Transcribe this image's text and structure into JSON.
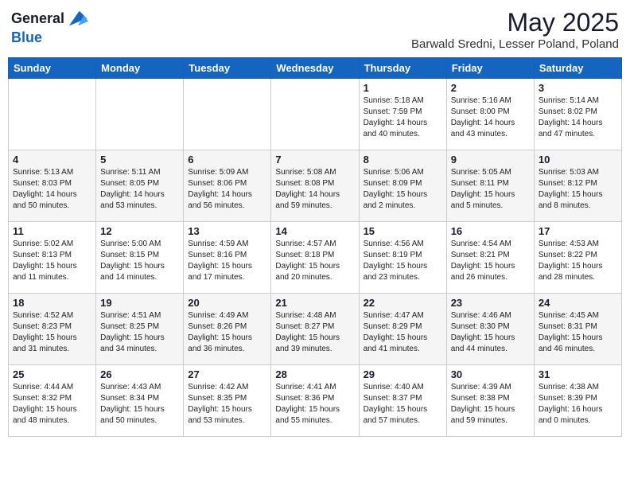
{
  "header": {
    "logo_line1": "General",
    "logo_line2": "Blue",
    "month": "May 2025",
    "location": "Barwald Sredni, Lesser Poland, Poland"
  },
  "weekdays": [
    "Sunday",
    "Monday",
    "Tuesday",
    "Wednesday",
    "Thursday",
    "Friday",
    "Saturday"
  ],
  "weeks": [
    [
      {
        "day": "",
        "info": ""
      },
      {
        "day": "",
        "info": ""
      },
      {
        "day": "",
        "info": ""
      },
      {
        "day": "",
        "info": ""
      },
      {
        "day": "1",
        "info": "Sunrise: 5:18 AM\nSunset: 7:59 PM\nDaylight: 14 hours\nand 40 minutes."
      },
      {
        "day": "2",
        "info": "Sunrise: 5:16 AM\nSunset: 8:00 PM\nDaylight: 14 hours\nand 43 minutes."
      },
      {
        "day": "3",
        "info": "Sunrise: 5:14 AM\nSunset: 8:02 PM\nDaylight: 14 hours\nand 47 minutes."
      }
    ],
    [
      {
        "day": "4",
        "info": "Sunrise: 5:13 AM\nSunset: 8:03 PM\nDaylight: 14 hours\nand 50 minutes."
      },
      {
        "day": "5",
        "info": "Sunrise: 5:11 AM\nSunset: 8:05 PM\nDaylight: 14 hours\nand 53 minutes."
      },
      {
        "day": "6",
        "info": "Sunrise: 5:09 AM\nSunset: 8:06 PM\nDaylight: 14 hours\nand 56 minutes."
      },
      {
        "day": "7",
        "info": "Sunrise: 5:08 AM\nSunset: 8:08 PM\nDaylight: 14 hours\nand 59 minutes."
      },
      {
        "day": "8",
        "info": "Sunrise: 5:06 AM\nSunset: 8:09 PM\nDaylight: 15 hours\nand 2 minutes."
      },
      {
        "day": "9",
        "info": "Sunrise: 5:05 AM\nSunset: 8:11 PM\nDaylight: 15 hours\nand 5 minutes."
      },
      {
        "day": "10",
        "info": "Sunrise: 5:03 AM\nSunset: 8:12 PM\nDaylight: 15 hours\nand 8 minutes."
      }
    ],
    [
      {
        "day": "11",
        "info": "Sunrise: 5:02 AM\nSunset: 8:13 PM\nDaylight: 15 hours\nand 11 minutes."
      },
      {
        "day": "12",
        "info": "Sunrise: 5:00 AM\nSunset: 8:15 PM\nDaylight: 15 hours\nand 14 minutes."
      },
      {
        "day": "13",
        "info": "Sunrise: 4:59 AM\nSunset: 8:16 PM\nDaylight: 15 hours\nand 17 minutes."
      },
      {
        "day": "14",
        "info": "Sunrise: 4:57 AM\nSunset: 8:18 PM\nDaylight: 15 hours\nand 20 minutes."
      },
      {
        "day": "15",
        "info": "Sunrise: 4:56 AM\nSunset: 8:19 PM\nDaylight: 15 hours\nand 23 minutes."
      },
      {
        "day": "16",
        "info": "Sunrise: 4:54 AM\nSunset: 8:21 PM\nDaylight: 15 hours\nand 26 minutes."
      },
      {
        "day": "17",
        "info": "Sunrise: 4:53 AM\nSunset: 8:22 PM\nDaylight: 15 hours\nand 28 minutes."
      }
    ],
    [
      {
        "day": "18",
        "info": "Sunrise: 4:52 AM\nSunset: 8:23 PM\nDaylight: 15 hours\nand 31 minutes."
      },
      {
        "day": "19",
        "info": "Sunrise: 4:51 AM\nSunset: 8:25 PM\nDaylight: 15 hours\nand 34 minutes."
      },
      {
        "day": "20",
        "info": "Sunrise: 4:49 AM\nSunset: 8:26 PM\nDaylight: 15 hours\nand 36 minutes."
      },
      {
        "day": "21",
        "info": "Sunrise: 4:48 AM\nSunset: 8:27 PM\nDaylight: 15 hours\nand 39 minutes."
      },
      {
        "day": "22",
        "info": "Sunrise: 4:47 AM\nSunset: 8:29 PM\nDaylight: 15 hours\nand 41 minutes."
      },
      {
        "day": "23",
        "info": "Sunrise: 4:46 AM\nSunset: 8:30 PM\nDaylight: 15 hours\nand 44 minutes."
      },
      {
        "day": "24",
        "info": "Sunrise: 4:45 AM\nSunset: 8:31 PM\nDaylight: 15 hours\nand 46 minutes."
      }
    ],
    [
      {
        "day": "25",
        "info": "Sunrise: 4:44 AM\nSunset: 8:32 PM\nDaylight: 15 hours\nand 48 minutes."
      },
      {
        "day": "26",
        "info": "Sunrise: 4:43 AM\nSunset: 8:34 PM\nDaylight: 15 hours\nand 50 minutes."
      },
      {
        "day": "27",
        "info": "Sunrise: 4:42 AM\nSunset: 8:35 PM\nDaylight: 15 hours\nand 53 minutes."
      },
      {
        "day": "28",
        "info": "Sunrise: 4:41 AM\nSunset: 8:36 PM\nDaylight: 15 hours\nand 55 minutes."
      },
      {
        "day": "29",
        "info": "Sunrise: 4:40 AM\nSunset: 8:37 PM\nDaylight: 15 hours\nand 57 minutes."
      },
      {
        "day": "30",
        "info": "Sunrise: 4:39 AM\nSunset: 8:38 PM\nDaylight: 15 hours\nand 59 minutes."
      },
      {
        "day": "31",
        "info": "Sunrise: 4:38 AM\nSunset: 8:39 PM\nDaylight: 16 hours\nand 0 minutes."
      }
    ]
  ]
}
